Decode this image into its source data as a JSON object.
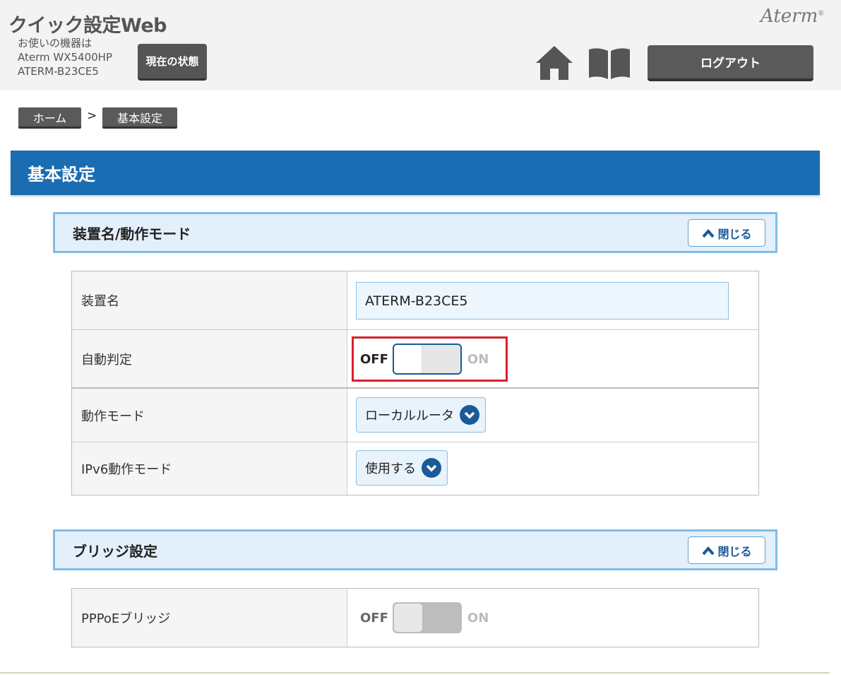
{
  "header": {
    "app_title": "クイック設定Web",
    "device_line1": "お使いの機器は",
    "device_line2": "Aterm WX5400HP",
    "device_line3": "ATERM-B23CE5",
    "status_button": "現在の状態",
    "brand": "Aterm",
    "logout_button": "ログアウト",
    "home_icon": "home-icon",
    "manual_icon": "book-icon"
  },
  "breadcrumb": {
    "home": "ホーム",
    "separator": ">",
    "current": "基本設定"
  },
  "page_title": "基本設定",
  "section1": {
    "title": "装置名/動作モード",
    "close_label": "閉じる",
    "rows": {
      "device_name_label": "装置名",
      "device_name_value": "ATERM-B23CE5",
      "auto_detect_label": "自動判定",
      "auto_detect_off": "OFF",
      "auto_detect_on": "ON",
      "auto_detect_state": "OFF",
      "operation_mode_label": "動作モード",
      "operation_mode_value": "ローカルルータ",
      "ipv6_mode_label": "IPv6動作モード",
      "ipv6_mode_value": "使用する"
    }
  },
  "section2": {
    "title": "ブリッジ設定",
    "close_label": "閉じる",
    "rows": {
      "pppoe_label": "PPPoEブリッジ",
      "pppoe_off": "OFF",
      "pppoe_on": "ON",
      "pppoe_state": "OFF",
      "pppoe_disabled": true
    }
  },
  "colors": {
    "title_bar": "#1a6cb3",
    "section_border": "#7fbde6",
    "highlight": "#d9202e",
    "dark_button": "#5a5a5a"
  }
}
